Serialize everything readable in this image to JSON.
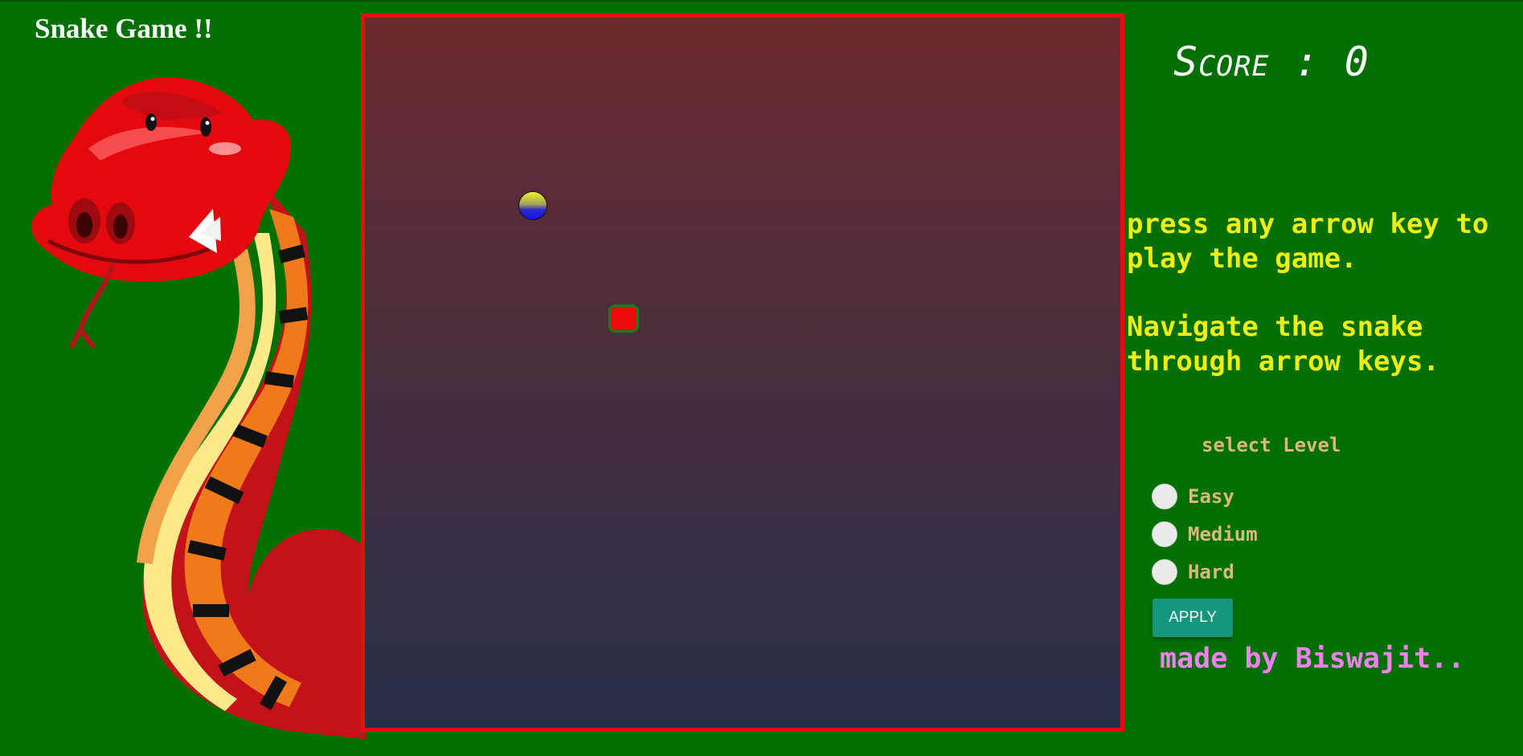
{
  "page": {
    "title": "Snake Game !!"
  },
  "game": {
    "score_label": "Score : 0",
    "colors": {
      "background": "#017001",
      "board_border": "#e50d0d",
      "board_top": "#6c2a2f",
      "board_bottom": "#283049",
      "snake_head": "#f10a0a",
      "food_top": "#f1f12a",
      "food_bottom": "#1212ee"
    }
  },
  "instructions": {
    "line1": "press any arrow key to play the game.",
    "line2": "Navigate the snake through arrow keys."
  },
  "levels": {
    "title": "select Level",
    "options": [
      {
        "label": "Easy",
        "selected": false
      },
      {
        "label": "Medium",
        "selected": false
      },
      {
        "label": "Hard",
        "selected": false
      }
    ],
    "apply_label": "APPLY"
  },
  "credit": "made by Biswajit.."
}
